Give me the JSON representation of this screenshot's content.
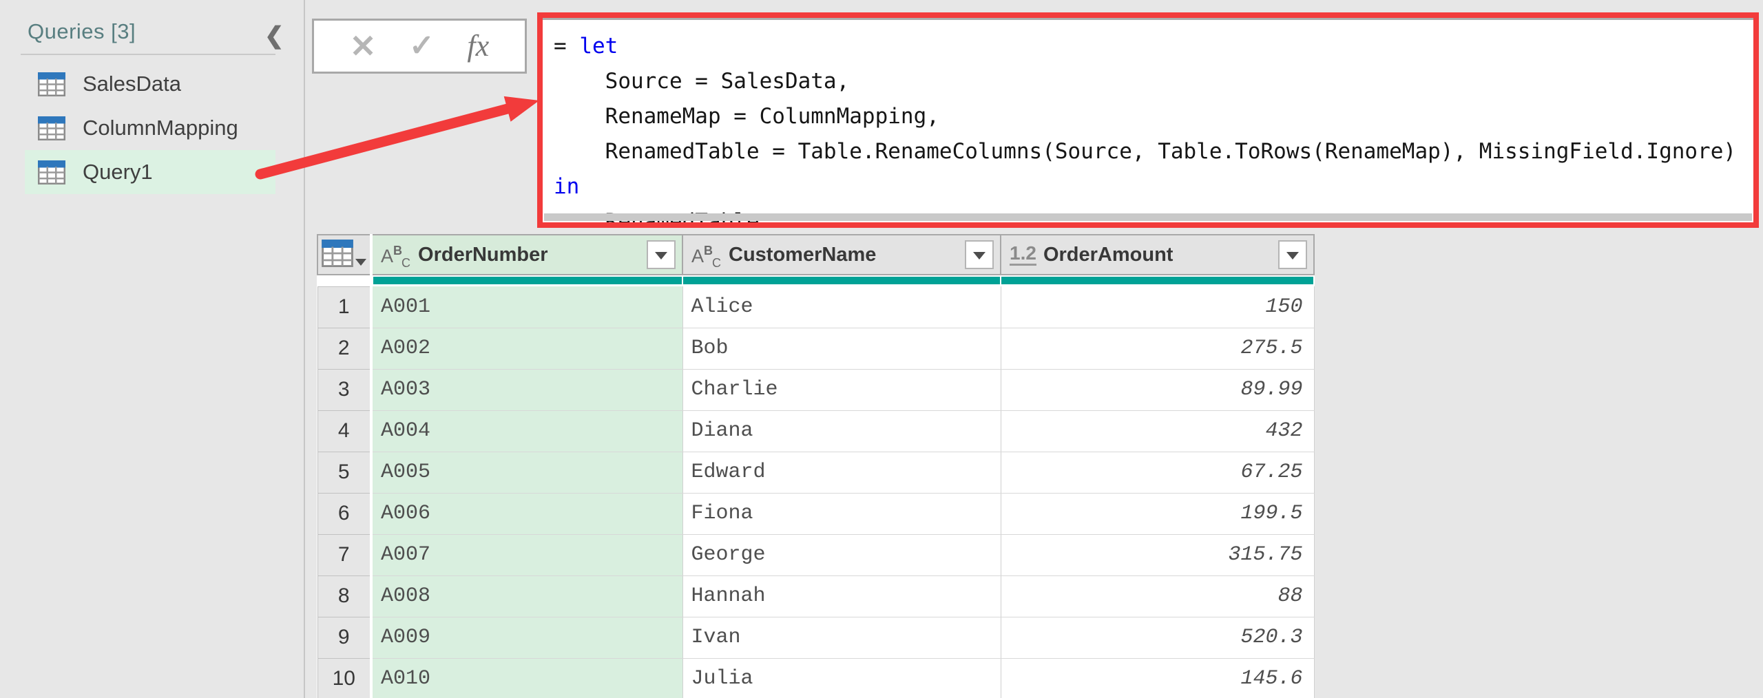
{
  "colors": {
    "annotation_red": "#f23b3b",
    "keyword_blue": "#0000ee",
    "quality_bar_teal": "#00a296",
    "sidebar_selection_green": "#dcf2e3",
    "column_selection_green": "#d9efdf",
    "table_icon_blue": "#2e77bc"
  },
  "sidebar": {
    "header": "Queries [3]",
    "collapse_icon": "chevron-left",
    "items": [
      {
        "label": "SalesData",
        "icon": "table-icon",
        "selected": false
      },
      {
        "label": "ColumnMapping",
        "icon": "table-icon",
        "selected": false
      },
      {
        "label": "Query1",
        "icon": "table-icon",
        "selected": true
      }
    ]
  },
  "formula_bar": {
    "cancel_label": "✕",
    "accept_label": "✓",
    "fx_label": "fx"
  },
  "formula": {
    "lines": [
      {
        "segments": [
          {
            "text": "= ",
            "keyword": false
          },
          {
            "text": "let",
            "keyword": true
          }
        ]
      },
      {
        "segments": [
          {
            "text": "    Source = SalesData,",
            "keyword": false
          }
        ]
      },
      {
        "segments": [
          {
            "text": "    RenameMap = ColumnMapping,",
            "keyword": false
          }
        ]
      },
      {
        "segments": [
          {
            "text": "    RenamedTable = Table.RenameColumns(Source, Table.ToRows(RenameMap), MissingField.Ignore)",
            "keyword": false
          }
        ]
      },
      {
        "segments": [
          {
            "text": "in",
            "keyword": true
          }
        ]
      },
      {
        "segments": [
          {
            "text": "    RenamedTable",
            "keyword": false
          }
        ]
      }
    ]
  },
  "table": {
    "columns": [
      {
        "type": "text",
        "type_icon": "ABC",
        "label": "OrderNumber",
        "selected": true
      },
      {
        "type": "text",
        "type_icon": "ABC",
        "label": "CustomerName",
        "selected": false
      },
      {
        "type": "number",
        "type_icon": "1.2",
        "label": "OrderAmount",
        "selected": false
      }
    ],
    "rows": [
      {
        "num": "1",
        "order_number": "A001",
        "customer_name": "Alice",
        "order_amount": "150"
      },
      {
        "num": "2",
        "order_number": "A002",
        "customer_name": "Bob",
        "order_amount": "275.5"
      },
      {
        "num": "3",
        "order_number": "A003",
        "customer_name": "Charlie",
        "order_amount": "89.99"
      },
      {
        "num": "4",
        "order_number": "A004",
        "customer_name": "Diana",
        "order_amount": "432"
      },
      {
        "num": "5",
        "order_number": "A005",
        "customer_name": "Edward",
        "order_amount": "67.25"
      },
      {
        "num": "6",
        "order_number": "A006",
        "customer_name": "Fiona",
        "order_amount": "199.5"
      },
      {
        "num": "7",
        "order_number": "A007",
        "customer_name": "George",
        "order_amount": "315.75"
      },
      {
        "num": "8",
        "order_number": "A008",
        "customer_name": "Hannah",
        "order_amount": "88"
      },
      {
        "num": "9",
        "order_number": "A009",
        "customer_name": "Ivan",
        "order_amount": "520.3"
      },
      {
        "num": "10",
        "order_number": "A010",
        "customer_name": "Julia",
        "order_amount": "145.6"
      }
    ]
  }
}
